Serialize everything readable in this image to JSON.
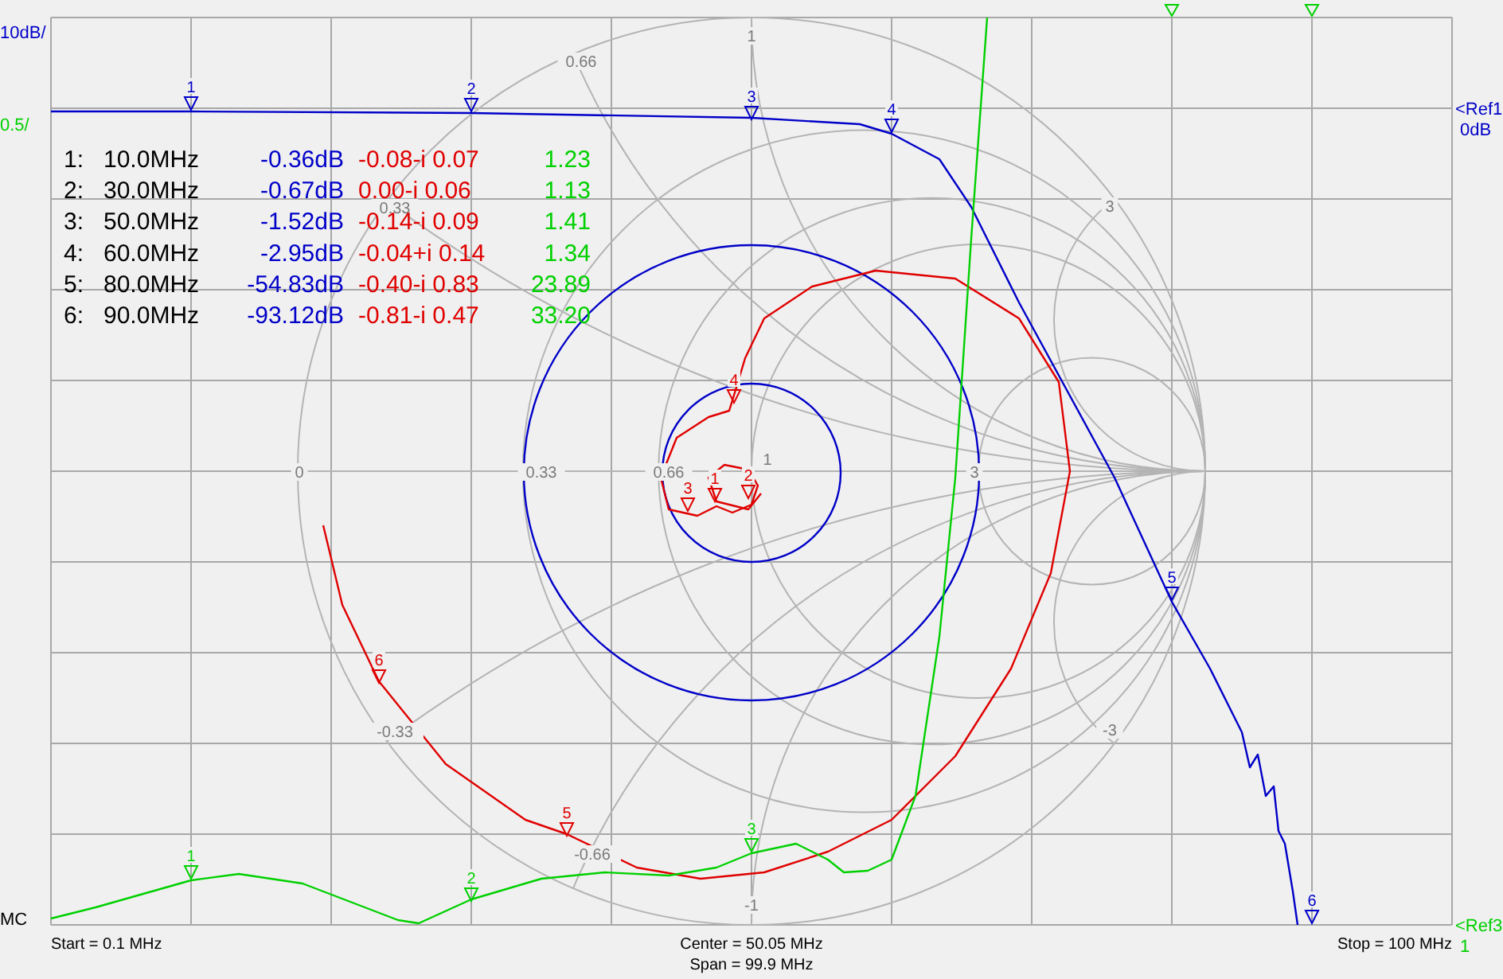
{
  "traces": [
    {
      "kind": "logmag",
      "color": "#0000c8",
      "scale": "10dB/",
      "ref_label": "<Ref1",
      "ref_value": "0dB",
      "markers": [
        "1",
        "2",
        "3",
        "4",
        "5",
        "6"
      ]
    },
    {
      "kind": "smith",
      "color": "#e00000",
      "markers": [
        "1",
        "2",
        "3",
        "4",
        "5",
        "6"
      ]
    },
    {
      "kind": "swr",
      "color": "#00d000",
      "scale": "0.5/",
      "ref_label": "<Ref3",
      "ref_value": "1",
      "markers": [
        "1",
        "2",
        "3"
      ]
    }
  ],
  "format_label": "MC",
  "smith_labels": [
    "1",
    "0.66",
    "0.33",
    "0",
    "0.33",
    "0.66",
    "1",
    "3",
    "3",
    "-3",
    "-0.33",
    "-0.66",
    "-1"
  ],
  "marker_table": [
    {
      "index": "1:",
      "freq": "10.0MHz",
      "logmag": "-0.36dB",
      "impedance": "-0.08-i 0.07",
      "swr": "1.23"
    },
    {
      "index": "2:",
      "freq": "30.0MHz",
      "logmag": "-0.67dB",
      "impedance": "0.00-i 0.06",
      "swr": "1.13"
    },
    {
      "index": "3:",
      "freq": "50.0MHz",
      "logmag": "-1.52dB",
      "impedance": "-0.14-i 0.09",
      "swr": "1.41"
    },
    {
      "index": "4:",
      "freq": "60.0MHz",
      "logmag": "-2.95dB",
      "impedance": "-0.04+i 0.14",
      "swr": "1.34"
    },
    {
      "index": "5:",
      "freq": "80.0MHz",
      "logmag": "-54.83dB",
      "impedance": "-0.40-i 0.83",
      "swr": "23.89"
    },
    {
      "index": "6:",
      "freq": "90.0MHz",
      "logmag": "-93.12dB",
      "impedance": "-0.81-i 0.47",
      "swr": "33.20"
    }
  ],
  "footer": {
    "start": "Start = 0.1 MHz",
    "center": "Center = 50.05 MHz",
    "span": "Span = 99.9 MHz",
    "stop": "Stop = 100 MHz"
  }
}
